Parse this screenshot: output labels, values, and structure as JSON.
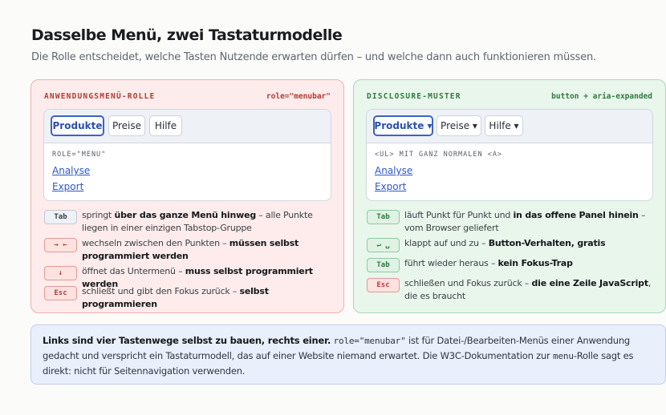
{
  "header": {
    "title": "Dasselbe Menü, zwei Tastaturmodelle",
    "subtitle": "Die Rolle entscheidet, welche Tasten Nutzende erwarten dürfen – und welche dann auch funktionieren müssen."
  },
  "left": {
    "tag": "ANWENDUNGSMENÜ-ROLLE",
    "role": "role=\"menubar\"",
    "tabs": [
      "Produkte",
      "Preise",
      "Hilfe"
    ],
    "submenu_kind": "ROLE=\"MENU\"",
    "links": [
      "Analyse",
      "Export"
    ],
    "rows": [
      {
        "key": "Tab",
        "pre": "springt ",
        "bold": "über das ganze Menü hinweg",
        "post": " – alle Punkte liegen in einer einzigen Tabstop-Gruppe"
      },
      {
        "key": "→ ←",
        "pre": "wechseln zwischen den Punkten – ",
        "bold": "müssen selbst programmiert werden",
        "post": ""
      },
      {
        "key": "↓",
        "pre": "öffnet das Untermenü – ",
        "bold": "muss selbst programmiert werden",
        "post": ""
      },
      {
        "key": "Esc",
        "pre": "schließt und gibt den Fokus zurück – ",
        "bold": "selbst programmieren",
        "post": ""
      }
    ]
  },
  "right": {
    "tag": "DISCLOSURE-MUSTER",
    "role": "button + aria-expanded",
    "tabs": [
      "Produkte ▾",
      "Preise ▾",
      "Hilfe ▾"
    ],
    "submenu_kind": "<UL> MIT GANZ NORMALEN <A>",
    "links": [
      "Analyse",
      "Export"
    ],
    "rows": [
      {
        "key": "Tab",
        "pre": "läuft Punkt für Punkt und ",
        "bold": "in das offene Panel hinein",
        "post": " – vom Browser geliefert"
      },
      {
        "key": "↵ ␣",
        "pre": "klappt auf und zu – ",
        "bold": "Button-Verhalten, gratis",
        "post": ""
      },
      {
        "key": "Tab",
        "pre": "führt wieder heraus – ",
        "bold": "kein Fokus-Trap",
        "post": ""
      },
      {
        "key": "Esc",
        "pre": "schließen und Fokus zurück – ",
        "bold": "die eine Zeile JavaScript",
        "post": ", die es braucht"
      }
    ]
  },
  "note": {
    "bold": "Links sind vier Tastenwege selbst zu bauen, rechts einer.",
    "code1": "role=\"menubar\"",
    "t1": " ist für Datei-/Bearbeiten-Menüs einer Anwendung gedacht und verspricht ein Tastaturmodell, das auf einer Website niemand erwartet. Die W3C-Dokumentation zur ",
    "code2": "menu",
    "t2": "-Rolle sagt es direkt: nicht für Seitennavigation verwenden."
  },
  "colors": {
    "left_bg": "#fdeceb",
    "left_accent": "#b53a34",
    "right_bg": "#e9f6ec",
    "right_accent": "#2d7a3f",
    "note_bg": "#eaf0fb",
    "link": "#2d57c4",
    "active_tab": "#3b63c4"
  }
}
